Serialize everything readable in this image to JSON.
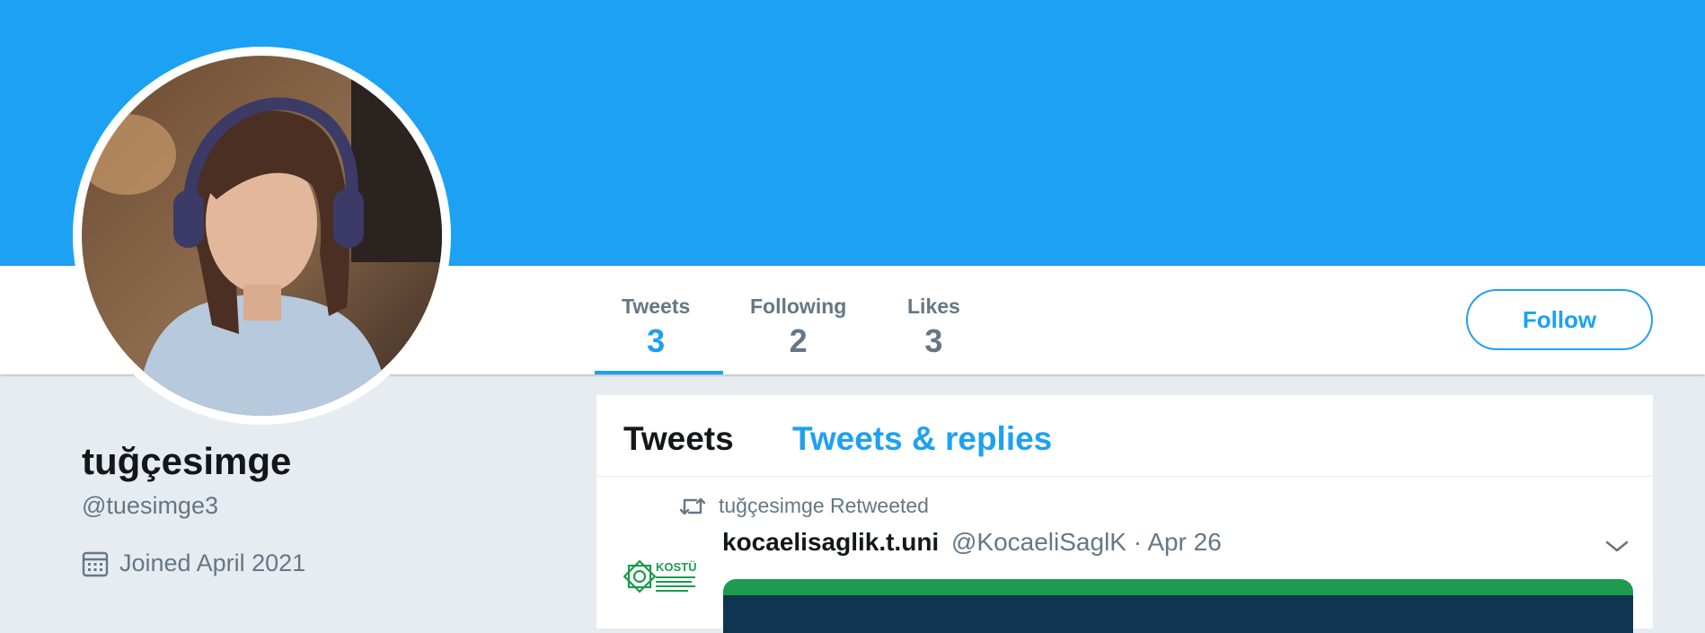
{
  "profile": {
    "name": "tuğçesimge",
    "handle": "@tuesimge3",
    "joined": "Joined April 2021"
  },
  "stats": [
    {
      "label": "Tweets",
      "value": "3"
    },
    {
      "label": "Following",
      "value": "2"
    },
    {
      "label": "Likes",
      "value": "3"
    }
  ],
  "follow_label": "Follow",
  "tabs": [
    {
      "label": "Tweets"
    },
    {
      "label": "Tweets & replies"
    }
  ],
  "tweet": {
    "retweet_text": "tuğçesimge Retweeted",
    "author_name": "kocaelisaglik.t.uni",
    "author_handle": "@KocaeliSaglK",
    "separator": "·",
    "date": "Apr 26",
    "avatar_text": "KOSTÜ"
  },
  "icons": {
    "retweet": "retweet-icon",
    "calendar": "calendar-icon",
    "chevron": "chevron-down-icon"
  },
  "colors": {
    "accent": "#1da1f2",
    "muted": "#657786",
    "background": "#e6ecf0"
  }
}
